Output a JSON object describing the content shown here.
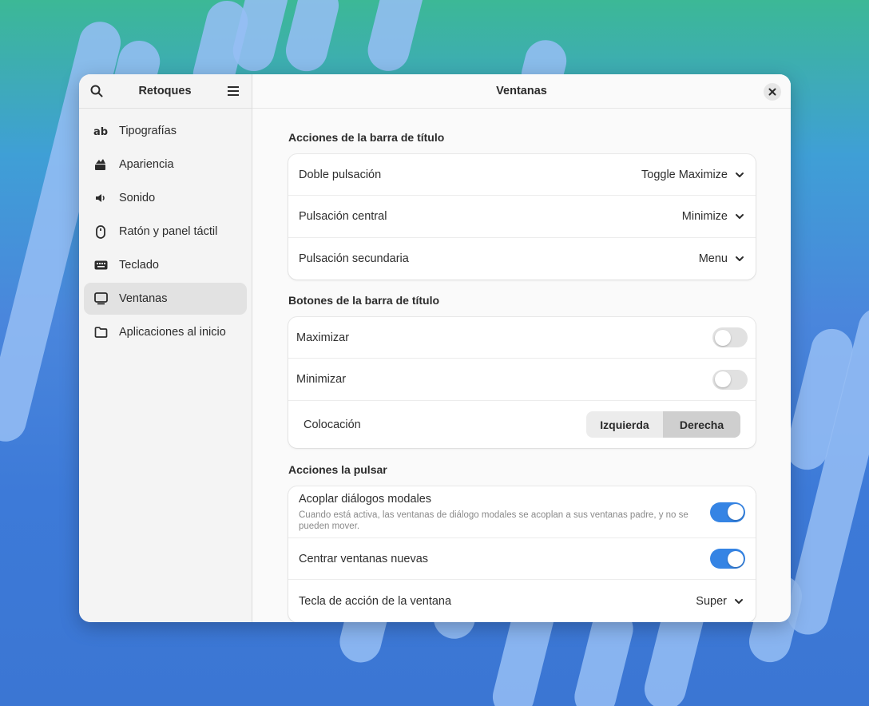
{
  "sidebar": {
    "title": "Retoques",
    "search_icon": "search-icon",
    "menu_icon": "hamburger-menu-icon",
    "items": [
      {
        "label": "Tipografías",
        "icon": "font-icon"
      },
      {
        "label": "Apariencia",
        "icon": "appearance-icon"
      },
      {
        "label": "Sonido",
        "icon": "speaker-icon"
      },
      {
        "label": "Ratón y panel táctil",
        "icon": "mouse-icon"
      },
      {
        "label": "Teclado",
        "icon": "keyboard-icon"
      },
      {
        "label": "Ventanas",
        "icon": "window-icon",
        "active": true
      },
      {
        "label": "Aplicaciones al inicio",
        "icon": "folder-icon"
      }
    ]
  },
  "header": {
    "title": "Ventanas",
    "close_icon": "close-icon"
  },
  "titlebar_actions": {
    "title": "Acciones de la barra de título",
    "rows": [
      {
        "label": "Doble pulsación",
        "value": "Toggle Maximize"
      },
      {
        "label": "Pulsación central",
        "value": "Minimize"
      },
      {
        "label": "Pulsación secundaria",
        "value": "Menu"
      }
    ]
  },
  "titlebar_buttons": {
    "title": "Botones de la barra de título",
    "maximize_label": "Maximizar",
    "maximize_on": false,
    "minimize_label": "Minimizar",
    "minimize_on": false,
    "placement_label": "Colocación",
    "placement_left": "Izquierda",
    "placement_right": "Derecha",
    "placement_selected": "Derecha"
  },
  "click_actions": {
    "title": "Acciones la pulsar",
    "attach_modal_label": "Acoplar diálogos modales",
    "attach_modal_desc": "Cuando está activa, las ventanas de diálogo modales se acoplan a sus ventanas padre, y no se pueden mover.",
    "attach_modal_on": true,
    "center_new_label": "Centrar ventanas nuevas",
    "center_new_on": true,
    "action_key_label": "Tecla de acción de la ventana",
    "action_key_value": "Super"
  },
  "colors": {
    "accent": "#3584e4",
    "window_bg": "#fafafa",
    "sidebar_bg": "#f4f4f4"
  }
}
